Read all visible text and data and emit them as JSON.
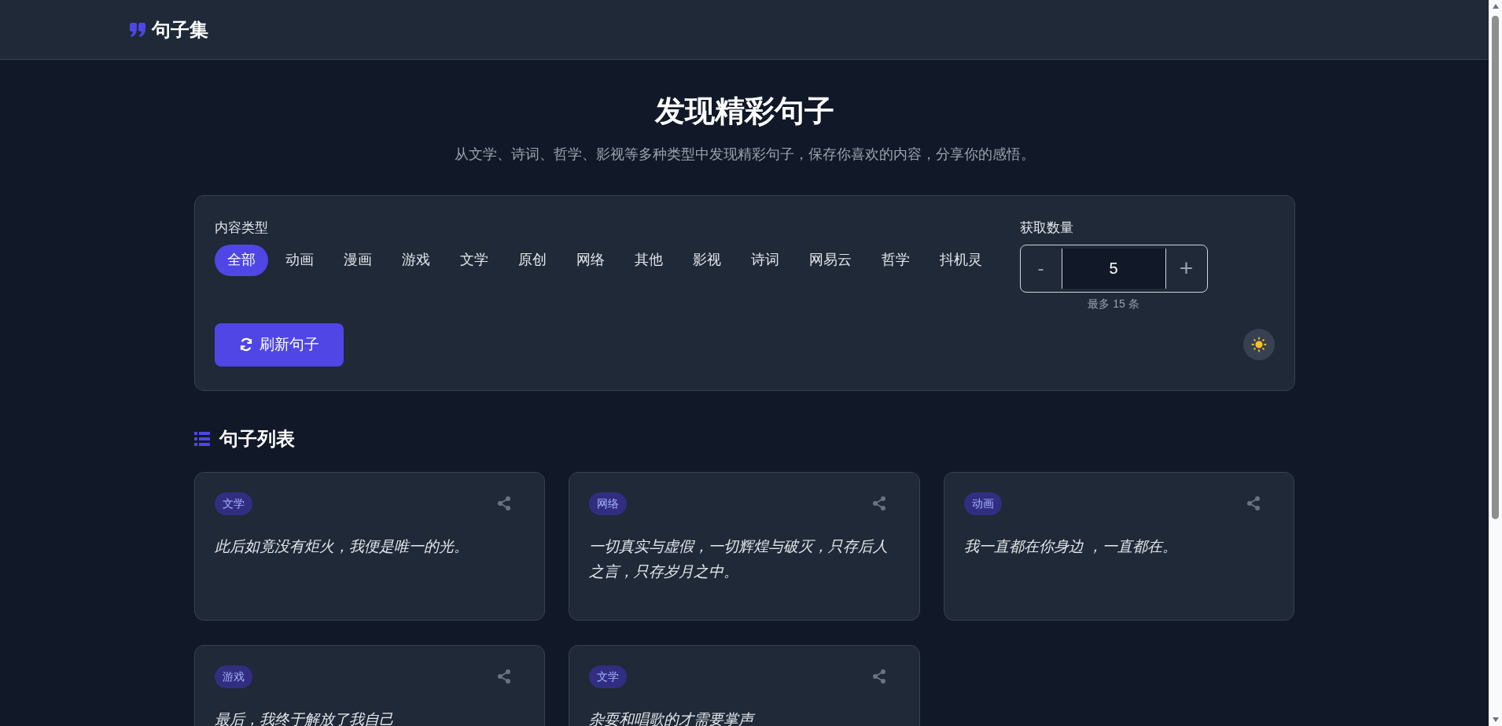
{
  "header": {
    "logo_text": "句子集"
  },
  "hero": {
    "title": "发现精彩句子",
    "subtitle": "从文学、诗词、哲学、影视等多种类型中发现精彩句子，保存你喜欢的内容，分享你的感悟。"
  },
  "filters": {
    "label": "内容类型",
    "types": [
      {
        "label": "全部",
        "selected": true
      },
      {
        "label": "动画",
        "selected": false
      },
      {
        "label": "漫画",
        "selected": false
      },
      {
        "label": "游戏",
        "selected": false
      },
      {
        "label": "文学",
        "selected": false
      },
      {
        "label": "原创",
        "selected": false
      },
      {
        "label": "网络",
        "selected": false
      },
      {
        "label": "其他",
        "selected": false
      },
      {
        "label": "影视",
        "selected": false
      },
      {
        "label": "诗词",
        "selected": false
      },
      {
        "label": "网易云",
        "selected": false
      },
      {
        "label": "哲学",
        "selected": false
      },
      {
        "label": "抖机灵",
        "selected": false
      }
    ],
    "count": {
      "label": "获取数量",
      "minus": "-",
      "value": "5",
      "plus": "+",
      "hint": "最多 15 条"
    },
    "refresh_button": "刷新句子"
  },
  "list": {
    "title": "句子列表",
    "cards": [
      {
        "tag": "文学",
        "text": "此后如竟没有炬火，我便是唯一的光。"
      },
      {
        "tag": "网络",
        "text": "一切真实与虚假，一切辉煌与破灭，只存后人之言，只存岁月之中。"
      },
      {
        "tag": "动画",
        "text": "我一直都在你身边 ，一直都在。"
      },
      {
        "tag": "游戏",
        "text": "最后，我终于解放了我自己"
      },
      {
        "tag": "文学",
        "text": "杂耍和唱歌的才需要掌声"
      }
    ]
  }
}
